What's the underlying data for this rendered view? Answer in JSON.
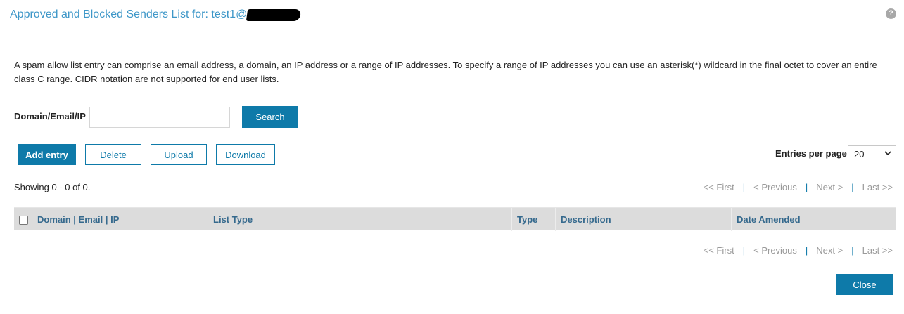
{
  "header": {
    "title": "Approved and Blocked Senders List for: test1@",
    "help_icon": "question-circle-icon",
    "help_glyph": "?"
  },
  "description": "A spam allow list entry can comprise an email address, a domain, an IP address or a range of IP addresses. To specify a range of IP addresses you can use an asterisk(*) wildcard in the final octet to cover an entire class C range. CIDR notation are not supported for end user lists.",
  "search": {
    "label": "Domain/Email/IP",
    "value": "",
    "placeholder": "",
    "button_label": "Search"
  },
  "toolbar": {
    "add_label": "Add entry",
    "delete_label": "Delete",
    "upload_label": "Upload",
    "download_label": "Download"
  },
  "entries_per_page": {
    "label": "Entries per page",
    "selected": "20"
  },
  "status": {
    "showing": "Showing 0 - 0 of 0."
  },
  "pager": {
    "first": "<< First",
    "previous": "< Previous",
    "next": "Next >",
    "last": "Last >>",
    "separator": "|"
  },
  "table": {
    "columns": [
      "Domain | Email | IP",
      "List Type",
      "Type",
      "Description",
      "Date Amended"
    ],
    "rows": []
  },
  "footer": {
    "close_label": "Close"
  },
  "colors": {
    "accent": "#0e7aa9",
    "title": "#3e97c8",
    "header_bg": "#dcdcdc",
    "header_text": "#35698d",
    "pager_disabled": "#9a9a9a"
  }
}
